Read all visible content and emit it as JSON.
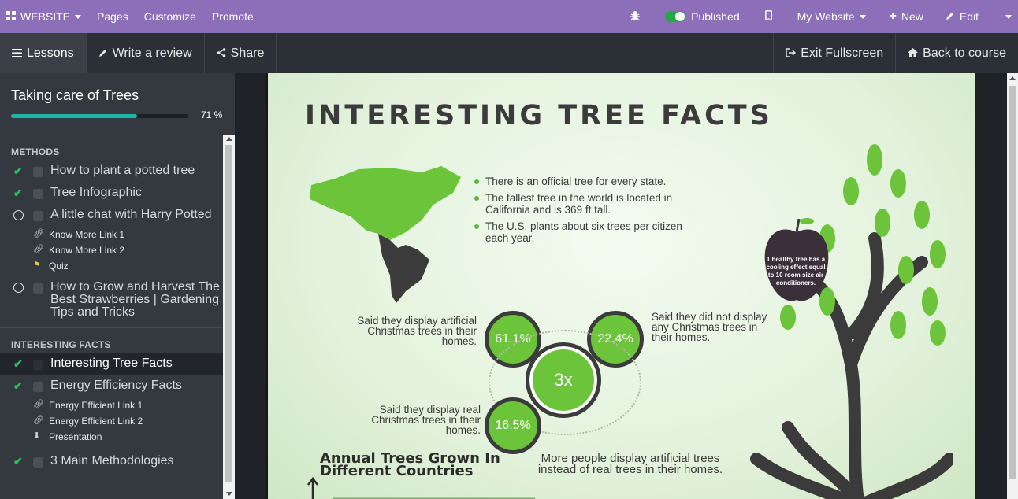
{
  "topbar": {
    "website_label": "WEBSITE",
    "pages": "Pages",
    "customize": "Customize",
    "promote": "Promote",
    "published": "Published",
    "my_website": "My Website",
    "new": "New",
    "edit": "Edit"
  },
  "nav": {
    "lessons": "Lessons",
    "write_review": "Write a review",
    "share": "Share",
    "exit_fullscreen": "Exit Fullscreen",
    "back_to_course": "Back to course"
  },
  "sidebar": {
    "course_title": "Taking care of Trees",
    "progress_percent": 71,
    "progress_label": "71 %",
    "sections": [
      {
        "title": "METHODS",
        "lessons": [
          {
            "label": "How to plant a potted tree",
            "done": true
          },
          {
            "label": "Tree Infographic",
            "done": true
          },
          {
            "label": "A little chat with Harry Potted",
            "done": false,
            "links": [
              "Know More Link 1",
              "Know More Link 2",
              "Quiz"
            ]
          },
          {
            "label": "How to Grow and Harvest The Best Strawberries | Gardening Tips and Tricks",
            "done": false
          }
        ]
      },
      {
        "title": "INTERESTING FACTS",
        "lessons": [
          {
            "label": "Interesting Tree Facts",
            "done": true,
            "active": true
          },
          {
            "label": "Energy Efficiency Facts",
            "done": true,
            "links": [
              "Energy Efficient Link 1",
              "Energy Efficient Link 2",
              "Presentation"
            ]
          },
          {
            "label": "3 Main Methodologies",
            "done": true
          }
        ]
      }
    ]
  },
  "infographic": {
    "title": "INTERESTING TREE FACTS",
    "facts": [
      "There is an official tree for every state.",
      "The tallest tree in the world is located in California and is 369 ft tall.",
      "The U.S. plants about six trees per citizen each year."
    ],
    "apple_text": "1 healthy tree has a cooling effect equal to 10 room size air conditioners.",
    "stat_artificial_text": "Said they display artificial Christmas trees in their homes.",
    "stat_artificial_value": "61.1%",
    "stat_none_text": "Said they did not display any Christmas trees in their homes.",
    "stat_none_value": "22.4%",
    "stat_center_value": "3x",
    "stat_real_text": "Said they display real Christmas trees in their homes.",
    "stat_real_value": "16.5%",
    "annual_title": "Annual Trees Grown In Different Countries",
    "more_people_text": "More people display artificial trees instead of real trees in their homes."
  },
  "colors": {
    "topbar": "#8c6fb8",
    "navbar": "#2b2f36",
    "sidebar": "#34393f",
    "progress": "#1fb5a4",
    "check": "#28c15c",
    "tree_green": "#6cc43a"
  }
}
